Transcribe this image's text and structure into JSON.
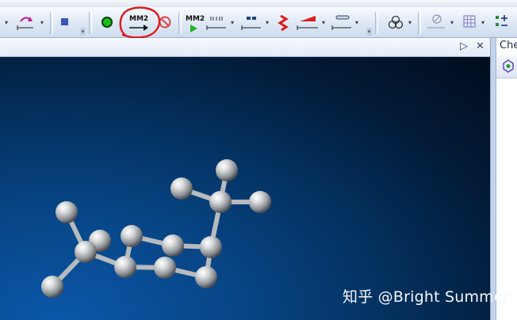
{
  "toolbar": {
    "mm2_minimize_label": "MM2",
    "mm2_dynamics_label": "MM2",
    "icons": [
      "rotate-tool-icon",
      "stop-icon",
      "run-green-dot-icon",
      "mm2-minimize-energy-icon",
      "stop-calculation-icon",
      "mm2-dynamics-icon",
      "measurement-icon",
      "plane-icon",
      "red-squiggle-icon",
      "red-wedge-icon",
      "bond-display-icon",
      "orbital-icon",
      "clip-icon",
      "grid-icon",
      "plus-minus-icon"
    ],
    "annotation_color": "#e01818"
  },
  "model_window": {
    "header_controls": [
      "▷",
      "✕"
    ],
    "background_colors": [
      "#0b57a8",
      "#010c1c"
    ]
  },
  "side_panel": {
    "title": "Che"
  },
  "watermark": "知乎 @Bright Summer"
}
